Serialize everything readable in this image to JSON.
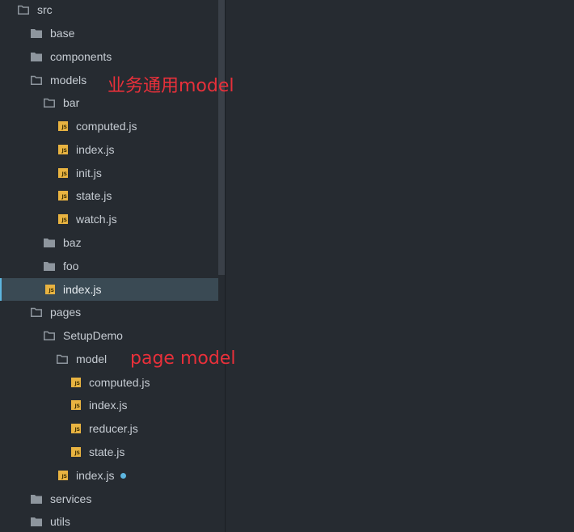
{
  "tree": [
    {
      "label": "src",
      "type": "folder-open"
    },
    {
      "label": "base",
      "type": "folder-closed"
    },
    {
      "label": "components",
      "type": "folder-closed"
    },
    {
      "label": "models",
      "type": "folder-open"
    },
    {
      "label": "bar",
      "type": "folder-open"
    },
    {
      "label": "computed.js",
      "type": "js"
    },
    {
      "label": "index.js",
      "type": "js"
    },
    {
      "label": "init.js",
      "type": "js"
    },
    {
      "label": "state.js",
      "type": "js"
    },
    {
      "label": "watch.js",
      "type": "js"
    },
    {
      "label": "baz",
      "type": "folder-closed"
    },
    {
      "label": "foo",
      "type": "folder-closed"
    },
    {
      "label": "index.js",
      "type": "js",
      "selected": true
    },
    {
      "label": "pages",
      "type": "folder-open"
    },
    {
      "label": "SetupDemo",
      "type": "folder-open"
    },
    {
      "label": "model",
      "type": "folder-open"
    },
    {
      "label": "computed.js",
      "type": "js"
    },
    {
      "label": "index.js",
      "type": "js"
    },
    {
      "label": "reducer.js",
      "type": "js"
    },
    {
      "label": "state.js",
      "type": "js"
    },
    {
      "label": "index.js",
      "type": "js",
      "modified": true
    },
    {
      "label": "services",
      "type": "folder-closed"
    },
    {
      "label": "utils",
      "type": "folder-closed"
    }
  ],
  "annotations": {
    "business_model": "业务通用model",
    "page_model": "page model"
  },
  "colors": {
    "background": "#262b31",
    "selected_row": "#3a4a54",
    "accent": "#5db6e0",
    "js_icon": "#e8b341",
    "annotation": "#e8303a"
  }
}
